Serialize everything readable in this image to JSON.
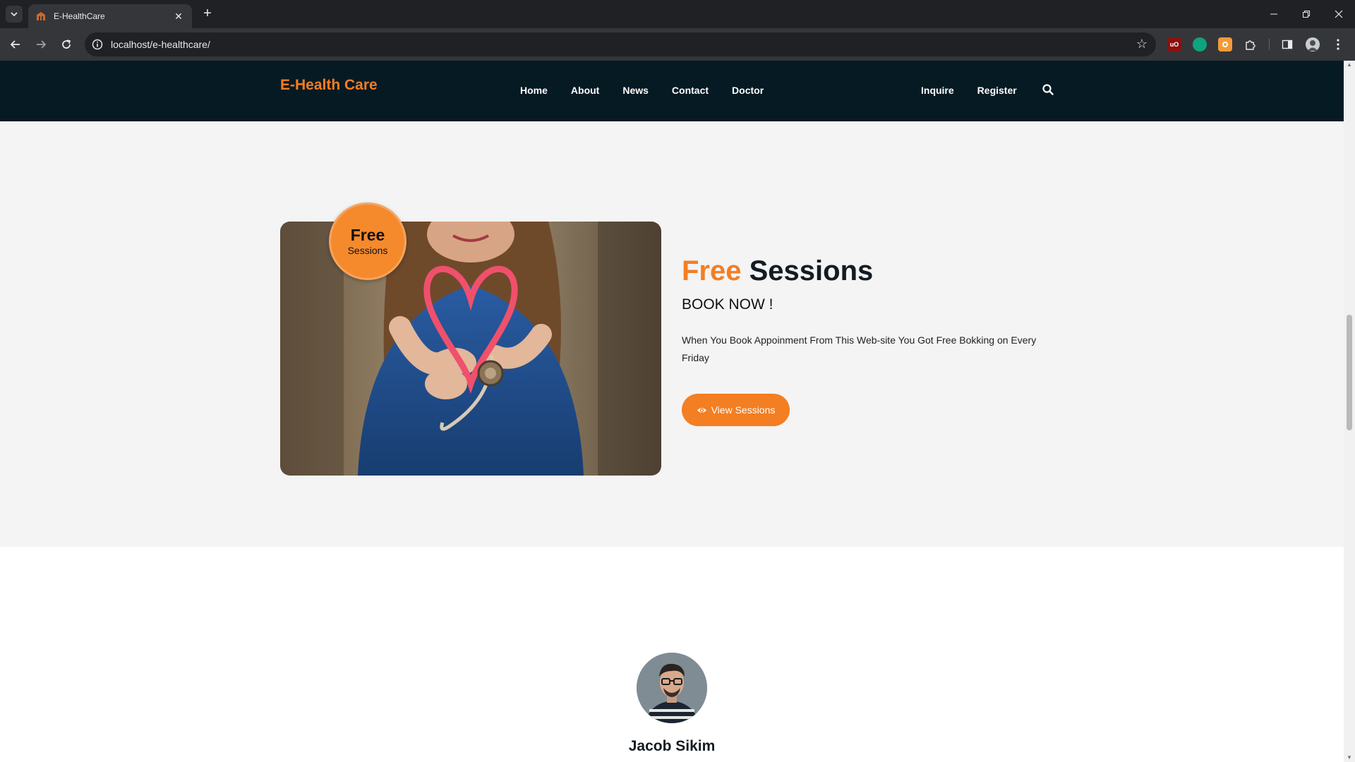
{
  "browser": {
    "tab_title": "E-HealthCare",
    "url": "localhost/e-healthcare/",
    "extensions": [
      {
        "name": "ublock-icon",
        "label": "uO",
        "color": "#8b1010"
      },
      {
        "name": "chatgpt-icon",
        "label": "",
        "color": "#10a37f"
      },
      {
        "name": "ext-orange-icon",
        "label": "",
        "color": "#f29b38"
      },
      {
        "name": "puzzle-icon",
        "label": "",
        "color": "#35363a"
      }
    ]
  },
  "site": {
    "logo": "E-Health Care",
    "nav": {
      "home": "Home",
      "about": "About",
      "news": "News",
      "contact": "Contact",
      "doctor": "Doctor",
      "inquire": "Inquire",
      "register": "Register"
    }
  },
  "promo": {
    "badge_title": "Free",
    "badge_sub": "Sessions",
    "heading_accent": "Free",
    "heading_rest": "Sessions",
    "subheading": "BOOK NOW !",
    "description": "When You Book Appoinment From This Web-site You Got Free Bokking on Every Friday",
    "button": "View Sessions",
    "accent_color": "#f47e22"
  },
  "team": {
    "member_name": "Jacob Sikim"
  }
}
